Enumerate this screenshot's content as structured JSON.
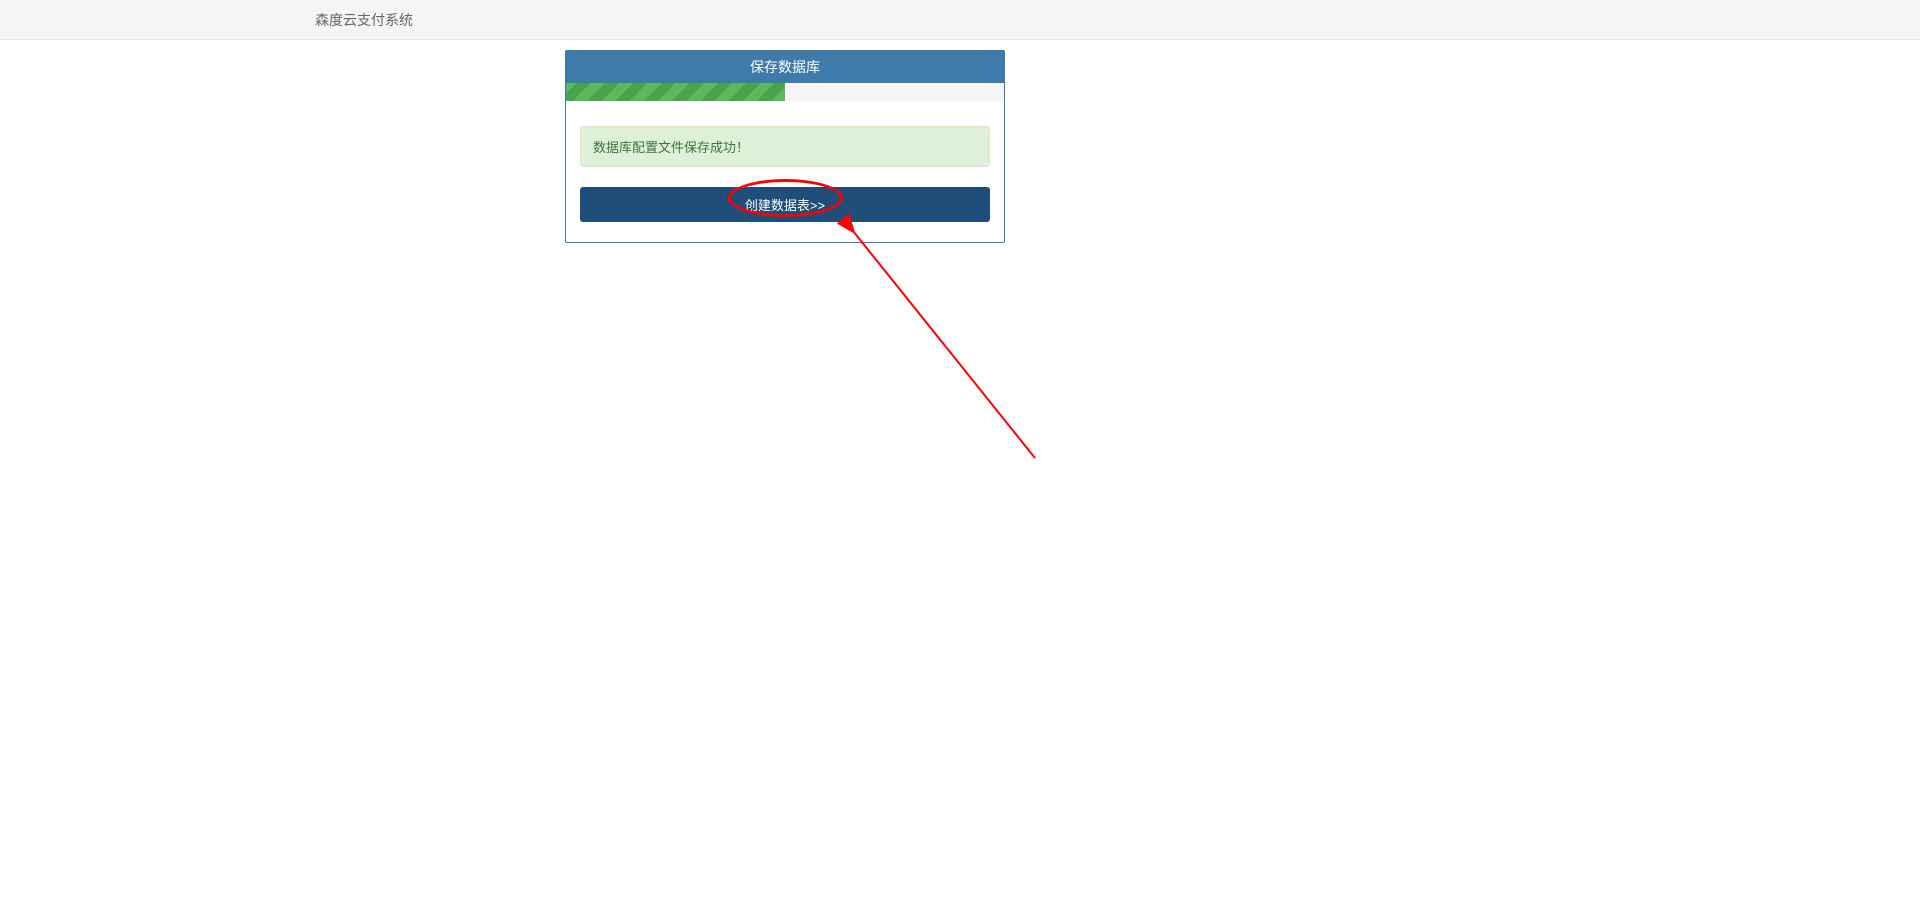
{
  "header": {
    "title": "森度云支付系统"
  },
  "panel": {
    "title": "保存数据库",
    "progress_percent": 50,
    "alert_message": "数据库配置文件保存成功！",
    "button_label": "创建数据表>>"
  }
}
